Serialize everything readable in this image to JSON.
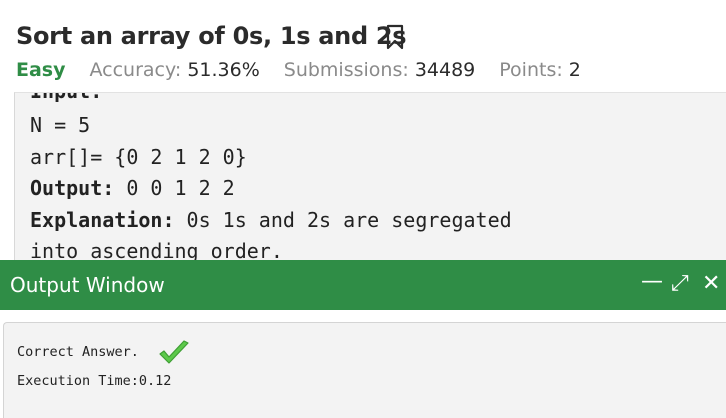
{
  "problem": {
    "title": "Sort an array of 0s, 1s and 2s",
    "difficulty": "Easy",
    "accuracy_label": "Accuracy:",
    "accuracy_value": "51.36%",
    "submissions_label": "Submissions:",
    "submissions_value": "34489",
    "points_label": "Points:",
    "points_value": "2"
  },
  "example": {
    "input_label": "Input:",
    "n_line": "N = 5",
    "arr_line": "arr[]= {0 2 1 2 0}",
    "output_label": "Output:",
    "output_value": " 0 0 1 2 2",
    "explanation_label": "Explanation:",
    "explanation_line1": " 0s 1s and 2s are segregated",
    "explanation_line2": "into ascending order."
  },
  "output_window": {
    "title": "Output Window",
    "minimize_glyph": "—",
    "expand_glyph": "⤢",
    "close_glyph": "✕",
    "result_text": "Correct Answer.",
    "execution_text": "Execution Time:0.12"
  },
  "colors": {
    "brand_green": "#2f8d46",
    "check_green": "#5cc94a"
  },
  "icons": {
    "bookmark": "bookmark-icon",
    "check": "checkmark-icon"
  }
}
